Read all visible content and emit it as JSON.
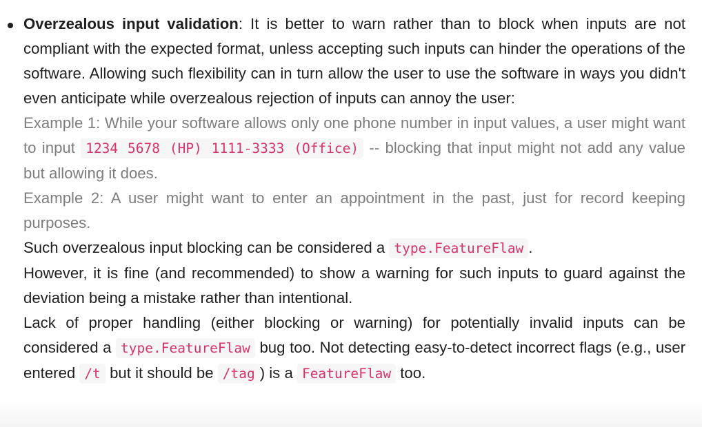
{
  "item": {
    "heading": "Overzealous input validation",
    "intro": ": It is better to warn rather than to block when inputs are not compliant with the expected format, unless accepting such inputs can hinder the operations of the software. Allowing such flexibility can in turn allow the user to use the software in ways you didn't even anticipate while overzealous rejection of inputs can annoy the user:",
    "example1": {
      "before": "Example 1: While your software allows only one phone number in input values, a user might want to input ",
      "code": "1234 5678 (HP) 1111-3333 (Office)",
      "after": " -- blocking that input might not add any value but allowing it does."
    },
    "example2": "Example 2: A user might want to enter an appointment in the past, just for record keeping purposes.",
    "blocking": {
      "before": "Such overzealous input blocking can be considered a ",
      "code": "type.FeatureFlaw",
      "after": "."
    },
    "however": "However, it is fine (and recommended) to show a warning for such inputs to guard against the deviation being a mistake rather than intentional.",
    "lack": {
      "part1": "Lack of proper handling (either blocking or warning) for potentially invalid inputs can be considered a ",
      "code1": "type.FeatureFlaw",
      "part2": " bug too. Not detecting easy-to-detect incorrect flags (e.g., user entered ",
      "code2": "/t",
      "part3": " but it should be ",
      "code3": "/tag",
      "part4": ") is a ",
      "code4": "FeatureFlaw",
      "part5": " too."
    }
  }
}
